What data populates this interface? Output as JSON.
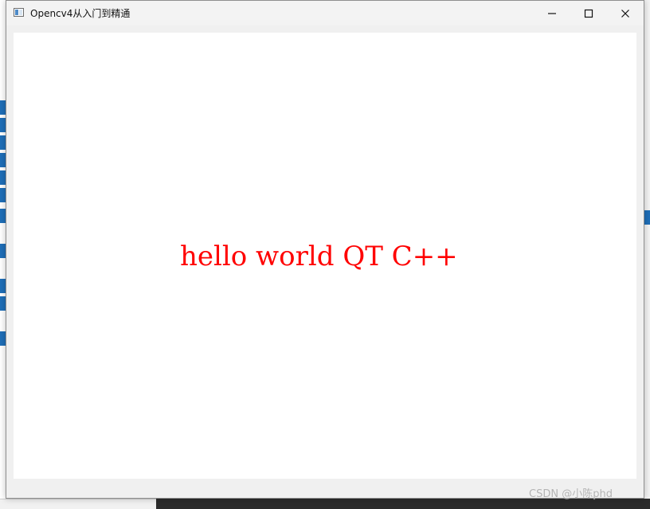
{
  "window": {
    "title": "Opencv4从入门到精通"
  },
  "content": {
    "text": "hello world QT C++",
    "text_color": "#ff0000"
  },
  "watermark": {
    "text": "CSDN @小陈phd"
  },
  "icons": {
    "app": "app-window-icon",
    "minimize": "minimize-icon",
    "maximize": "maximize-icon",
    "close": "close-icon"
  }
}
